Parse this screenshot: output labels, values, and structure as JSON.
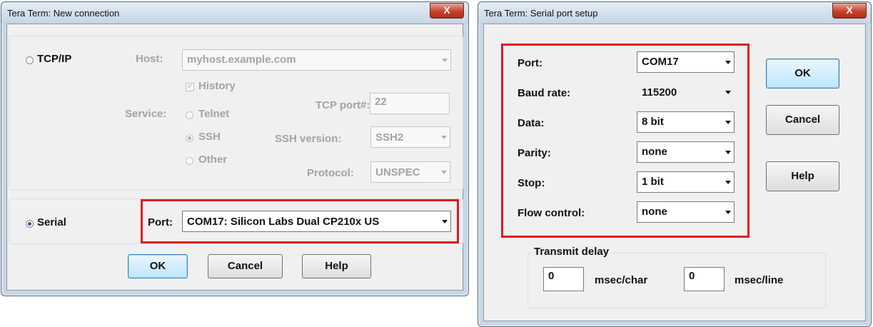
{
  "win1": {
    "title": "Tera Term: New connection",
    "close_glyph": "X",
    "tcpip_label": "TCP/IP",
    "host_label": "Host:",
    "host_value": "myhost.example.com",
    "history_label": "History",
    "history_checked": true,
    "tcp_port_label": "TCP port#:",
    "tcp_port_value": "22",
    "service_label": "Service:",
    "telnet_label": "Telnet",
    "ssh_label": "SSH",
    "other_label": "Other",
    "ssh_version_label": "SSH version:",
    "ssh_version_value": "SSH2",
    "protocol_label": "Protocol:",
    "protocol_value": "UNSPEC",
    "serial_label": "Serial",
    "port_label": "Port:",
    "port_value": "COM17: Silicon Labs Dual CP210x US",
    "ok_label": "OK",
    "cancel_label": "Cancel",
    "help_label": "Help"
  },
  "win2": {
    "title": "Tera Term: Serial port setup",
    "close_glyph": "X",
    "port_label": "Port:",
    "port_value": "COM17",
    "baud_label": "Baud rate:",
    "baud_value": "115200",
    "data_label": "Data:",
    "data_value": "8 bit",
    "parity_label": "Parity:",
    "parity_value": "none",
    "stop_label": "Stop:",
    "stop_value": "1 bit",
    "flow_label": "Flow control:",
    "flow_value": "none",
    "ok_label": "OK",
    "cancel_label": "Cancel",
    "help_label": "Help",
    "transmit_label": "Transmit delay",
    "char_delay_value": "0",
    "char_unit": "msec/char",
    "line_delay_value": "0",
    "line_unit": "msec/line"
  },
  "colors": {
    "highlight_box": "#e01a23",
    "titlebar": "#c9d7e6",
    "close_button": "#c7402a",
    "default_button": "#bee6fd"
  }
}
